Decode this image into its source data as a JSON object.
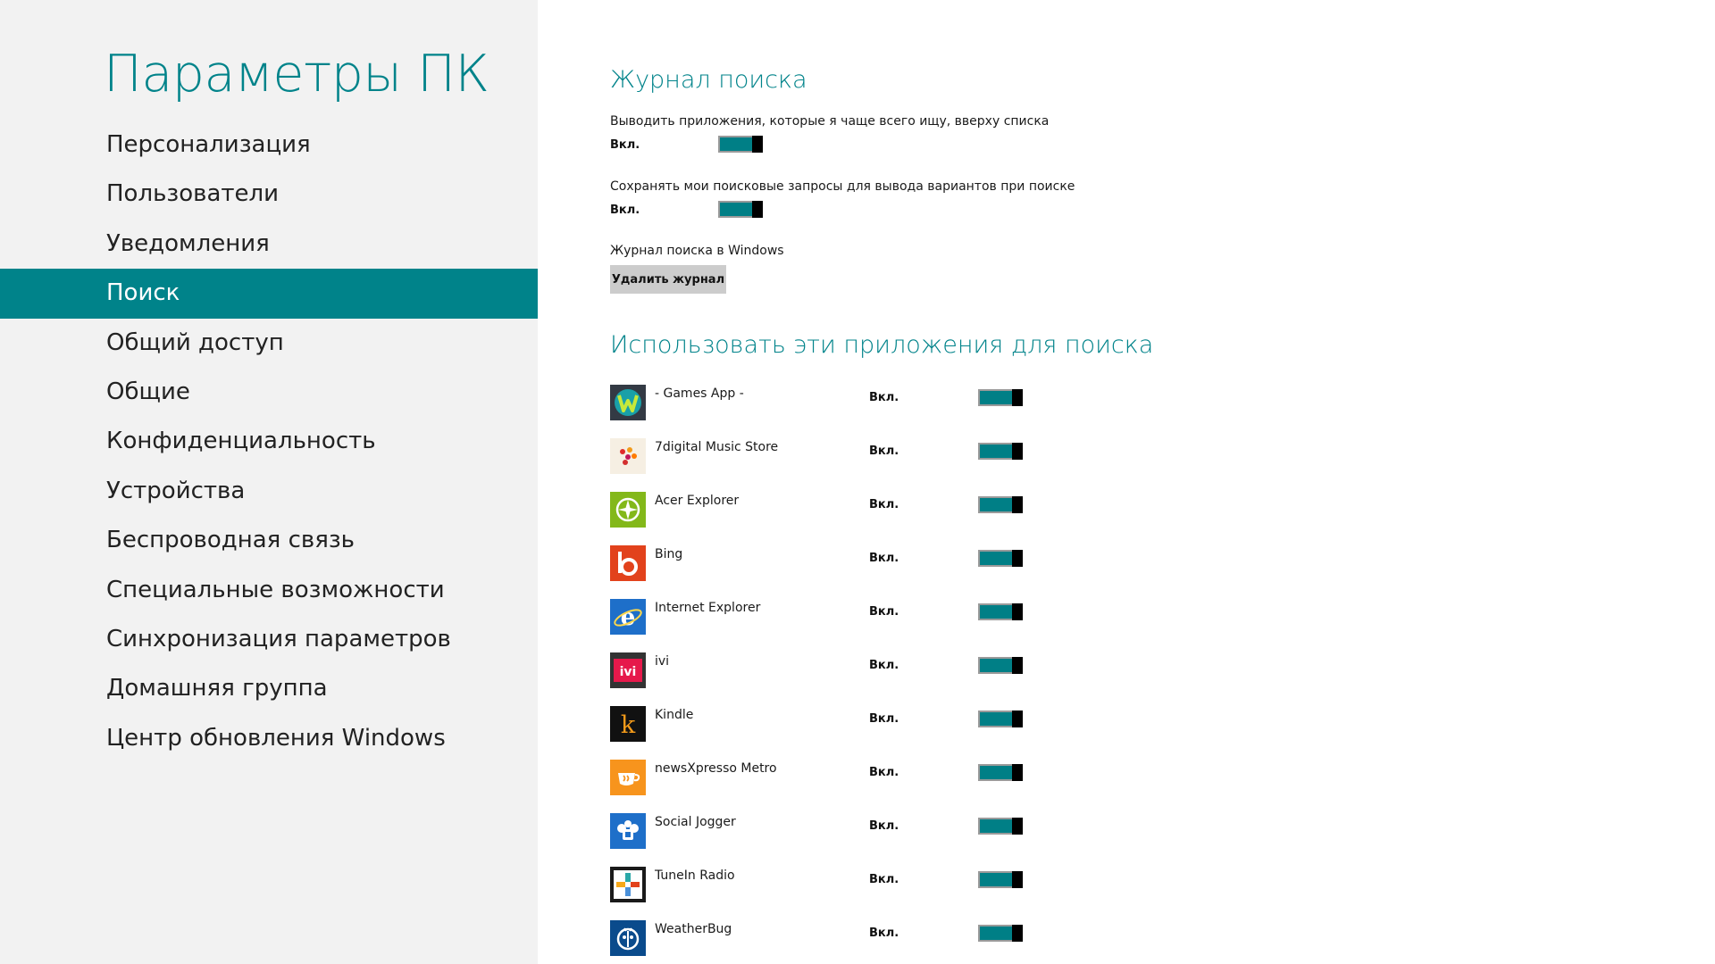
{
  "nav": {
    "title": "Параметры ПК",
    "items": [
      {
        "label": "Персонализация"
      },
      {
        "label": "Пользователи"
      },
      {
        "label": "Уведомления"
      },
      {
        "label": "Поиск"
      },
      {
        "label": "Общий доступ"
      },
      {
        "label": "Общие"
      },
      {
        "label": "Конфиденциальность"
      },
      {
        "label": "Устройства"
      },
      {
        "label": "Беспроводная связь"
      },
      {
        "label": "Специальные возможности"
      },
      {
        "label": "Синхронизация параметров"
      },
      {
        "label": "Домашняя группа"
      },
      {
        "label": "Центр обновления Windows"
      }
    ],
    "selected_label": "Поиск"
  },
  "search_history": {
    "title": "Журнал поиска",
    "frequent_apps": {
      "description": "Выводить приложения, которые я чаще всего ищу, вверху списка",
      "state": "Вкл."
    },
    "save_queries": {
      "description": "Сохранять мои поисковые запросы для вывода вариантов при поиске",
      "state": "Вкл."
    },
    "windows_history_label": "Журнал поиска в Windows",
    "delete_button": "Удалить журнал"
  },
  "search_apps": {
    "title": "Использовать эти приложения для поиска",
    "apps": [
      {
        "name": "- Games App -",
        "state": "Вкл.",
        "icon": "games-app-icon"
      },
      {
        "name": "7digital Music Store",
        "state": "Вкл.",
        "icon": "7digital-icon"
      },
      {
        "name": "Acer Explorer",
        "state": "Вкл.",
        "icon": "acer-explorer-icon"
      },
      {
        "name": "Bing",
        "state": "Вкл.",
        "icon": "bing-icon"
      },
      {
        "name": "Internet Explorer",
        "state": "Вкл.",
        "icon": "internet-explorer-icon"
      },
      {
        "name": "ivi",
        "state": "Вкл.",
        "icon": "ivi-icon"
      },
      {
        "name": "Kindle",
        "state": "Вкл.",
        "icon": "kindle-icon"
      },
      {
        "name": "newsXpresso Metro",
        "state": "Вкл.",
        "icon": "newsxpresso-icon"
      },
      {
        "name": "Social Jogger",
        "state": "Вкл.",
        "icon": "social-jogger-icon"
      },
      {
        "name": "TuneIn Radio",
        "state": "Вкл.",
        "icon": "tunein-radio-icon"
      },
      {
        "name": "WeatherBug",
        "state": "Вкл.",
        "icon": "weatherbug-icon"
      }
    ]
  },
  "colors": {
    "accent": "#00838a",
    "toggle_on": "#007f86",
    "nav_background": "#f2f2f2",
    "button_background": "#cccccc"
  }
}
